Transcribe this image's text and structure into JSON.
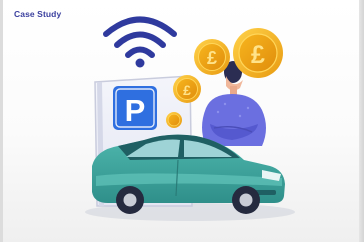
{
  "header": {
    "label": "Case Study"
  },
  "illustration": {
    "parking_sign_letter": "P",
    "coin_symbol": "£",
    "colors": {
      "header_text": "#3a3f9e",
      "wifi": "#2f3a9e",
      "sign_blue": "#2f6fe0",
      "coin_gold": "#f2b21c",
      "person_purple": "#6b6fe0",
      "car_teal": "#3aa7a0"
    }
  }
}
